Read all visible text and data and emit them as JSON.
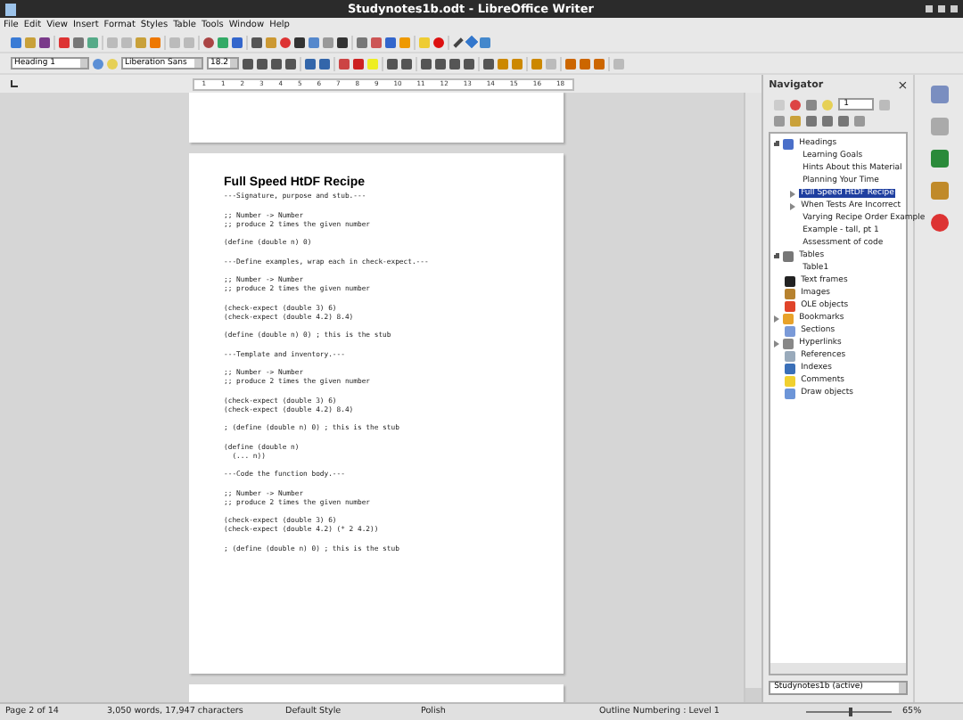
{
  "window": {
    "title": "Studynotes1b.odt - LibreOffice Writer"
  },
  "menu": [
    "File",
    "Edit",
    "View",
    "Insert",
    "Format",
    "Styles",
    "Table",
    "Tools",
    "Window",
    "Help"
  ],
  "formatting": {
    "paragraph_style": "Heading 1",
    "font": "Liberation Sans",
    "size": "18.2"
  },
  "ruler": [
    "1",
    "1",
    "2",
    "3",
    "4",
    "5",
    "6",
    "7",
    "8",
    "9",
    "10",
    "11",
    "12",
    "13",
    "14",
    "15",
    "16",
    "18"
  ],
  "document": {
    "title": "Full Speed HtDF Recipe",
    "blocks": [
      [
        "---Signature, purpose and stub.---"
      ],
      [
        ";; Number -> Number",
        ";; produce 2 times the given number"
      ],
      [
        "(define (double n) 0)"
      ],
      [
        "---Define examples, wrap each in check-expect.---"
      ],
      [
        ";; Number -> Number",
        ";; produce 2 times the given number"
      ],
      [
        "(check-expect (double 3) 6)",
        "(check-expect (double 4.2) 8.4)"
      ],
      [
        "(define (double n) 0) ; this is the stub"
      ],
      [
        "---Template and inventory.---"
      ],
      [
        ";; Number -> Number",
        ";; produce 2 times the given number"
      ],
      [
        "(check-expect (double 3) 6)",
        "(check-expect (double 4.2) 8.4)"
      ],
      [
        "; (define (double n) 0) ; this is the stub"
      ],
      [
        "(define (double n)",
        "  (... n))"
      ],
      [
        "---Code the function body.---"
      ],
      [
        ";; Number -> Number",
        ";; produce 2 times the given number"
      ],
      [
        "(check-expect (double 3) 6)",
        "(check-expect (double 4.2) (* 2 4.2))"
      ],
      [
        "; (define (double n) 0) ; this is the stub"
      ]
    ]
  },
  "navigator": {
    "title": "Navigator",
    "close": "×",
    "heading_level": "1",
    "tree": [
      {
        "label": "Headings",
        "kind": "headings",
        "expanded": true,
        "selected": false,
        "children": [
          {
            "label": "Learning Goals",
            "selected": false
          },
          {
            "label": "Hints About this Material",
            "selected": false
          },
          {
            "label": "Planning Your Time",
            "selected": false
          },
          {
            "label": "Full Speed HtDF Recipe",
            "expanded": false,
            "selected": true
          },
          {
            "label": "When Tests Are Incorrect",
            "expanded": false,
            "selected": false
          },
          {
            "label": "Varying Recipe Order Example",
            "selected": false
          },
          {
            "label": "Example - tall, pt 1",
            "selected": false
          },
          {
            "label": "Assessment of code",
            "selected": false
          }
        ]
      },
      {
        "label": "Tables",
        "kind": "tables",
        "expanded": true,
        "selected": false,
        "children": [
          {
            "label": "Table1",
            "selected": false
          }
        ]
      },
      {
        "label": "Text frames",
        "kind": "frames",
        "selected": false
      },
      {
        "label": "Images",
        "kind": "images",
        "selected": false
      },
      {
        "label": "OLE objects",
        "kind": "ole",
        "selected": false
      },
      {
        "label": "Bookmarks",
        "kind": "bookmarks",
        "expanded": false,
        "selected": false
      },
      {
        "label": "Sections",
        "kind": "sections",
        "selected": false
      },
      {
        "label": "Hyperlinks",
        "kind": "hyperlinks",
        "expanded": false,
        "selected": false
      },
      {
        "label": "References",
        "kind": "references",
        "selected": false
      },
      {
        "label": "Indexes",
        "kind": "indexes",
        "selected": false
      },
      {
        "label": "Comments",
        "kind": "comments",
        "selected": false
      },
      {
        "label": "Draw objects",
        "kind": "draw",
        "selected": false
      }
    ],
    "document_select": "Studynotes1b (active)"
  },
  "status_bar": {
    "page": "Page 2 of 14",
    "counts": "3,050 words, 17,947 characters",
    "page_style": "Default Style",
    "language": "Polish",
    "outline": "Outline Numbering : Level 1",
    "zoom_slider": {
      "level": 0.5
    },
    "zoom": "65%"
  }
}
